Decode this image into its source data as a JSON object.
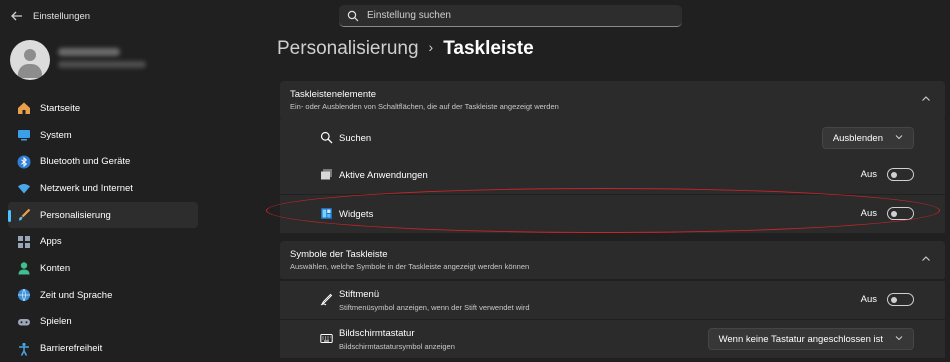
{
  "window": {
    "title": "Einstellungen"
  },
  "search": {
    "placeholder": "Einstellung suchen"
  },
  "nav": {
    "items": [
      {
        "label": "Startseite",
        "icon": "home-icon"
      },
      {
        "label": "System",
        "icon": "monitor-icon"
      },
      {
        "label": "Bluetooth und Geräte",
        "icon": "bluetooth-icon"
      },
      {
        "label": "Netzwerk und Internet",
        "icon": "wifi-icon"
      },
      {
        "label": "Personalisierung",
        "icon": "brush-icon",
        "active": true
      },
      {
        "label": "Apps",
        "icon": "apps-icon"
      },
      {
        "label": "Konten",
        "icon": "user-icon"
      },
      {
        "label": "Zeit und Sprache",
        "icon": "globe-icon"
      },
      {
        "label": "Spielen",
        "icon": "gamepad-icon"
      },
      {
        "label": "Barrierefreiheit",
        "icon": "accessibility-icon"
      }
    ]
  },
  "breadcrumb": {
    "parent": "Personalisierung",
    "separator": "›",
    "current": "Taskleiste"
  },
  "taskbar_items": {
    "title": "Taskleistenelemente",
    "subtitle": "Ein- oder Ausblenden von Schaltflächen, die auf der Taskleiste angezeigt werden",
    "rows": [
      {
        "label": "Suchen",
        "icon": "search-icon",
        "control": "dropdown",
        "value": "Ausblenden"
      },
      {
        "label": "Aktive Anwendungen",
        "icon": "task-view-icon",
        "control": "toggle",
        "state": "Aus"
      },
      {
        "label": "Widgets",
        "icon": "widgets-icon",
        "control": "toggle",
        "state": "Aus"
      }
    ]
  },
  "taskbar_symbols": {
    "title": "Symbole der Taskleiste",
    "subtitle": "Auswählen, welche Symbole in der Taskleiste angezeigt werden können",
    "rows": [
      {
        "label": "Stiftmenü",
        "sublabel": "Stiftmenüsymbol anzeigen, wenn der Stift verwendet wird",
        "icon": "pen-icon",
        "control": "toggle",
        "state": "Aus"
      },
      {
        "label": "Bildschirmtastatur",
        "sublabel": "Bildschirmtastatursymbol anzeigen",
        "icon": "keyboard-icon",
        "control": "dropdown",
        "value": "Wenn keine Tastatur angeschlossen ist"
      }
    ]
  },
  "colors": {
    "accent": "#4cc2ff",
    "highlight": "#c8242a",
    "background": "#202020",
    "card": "#2b2b2b"
  }
}
